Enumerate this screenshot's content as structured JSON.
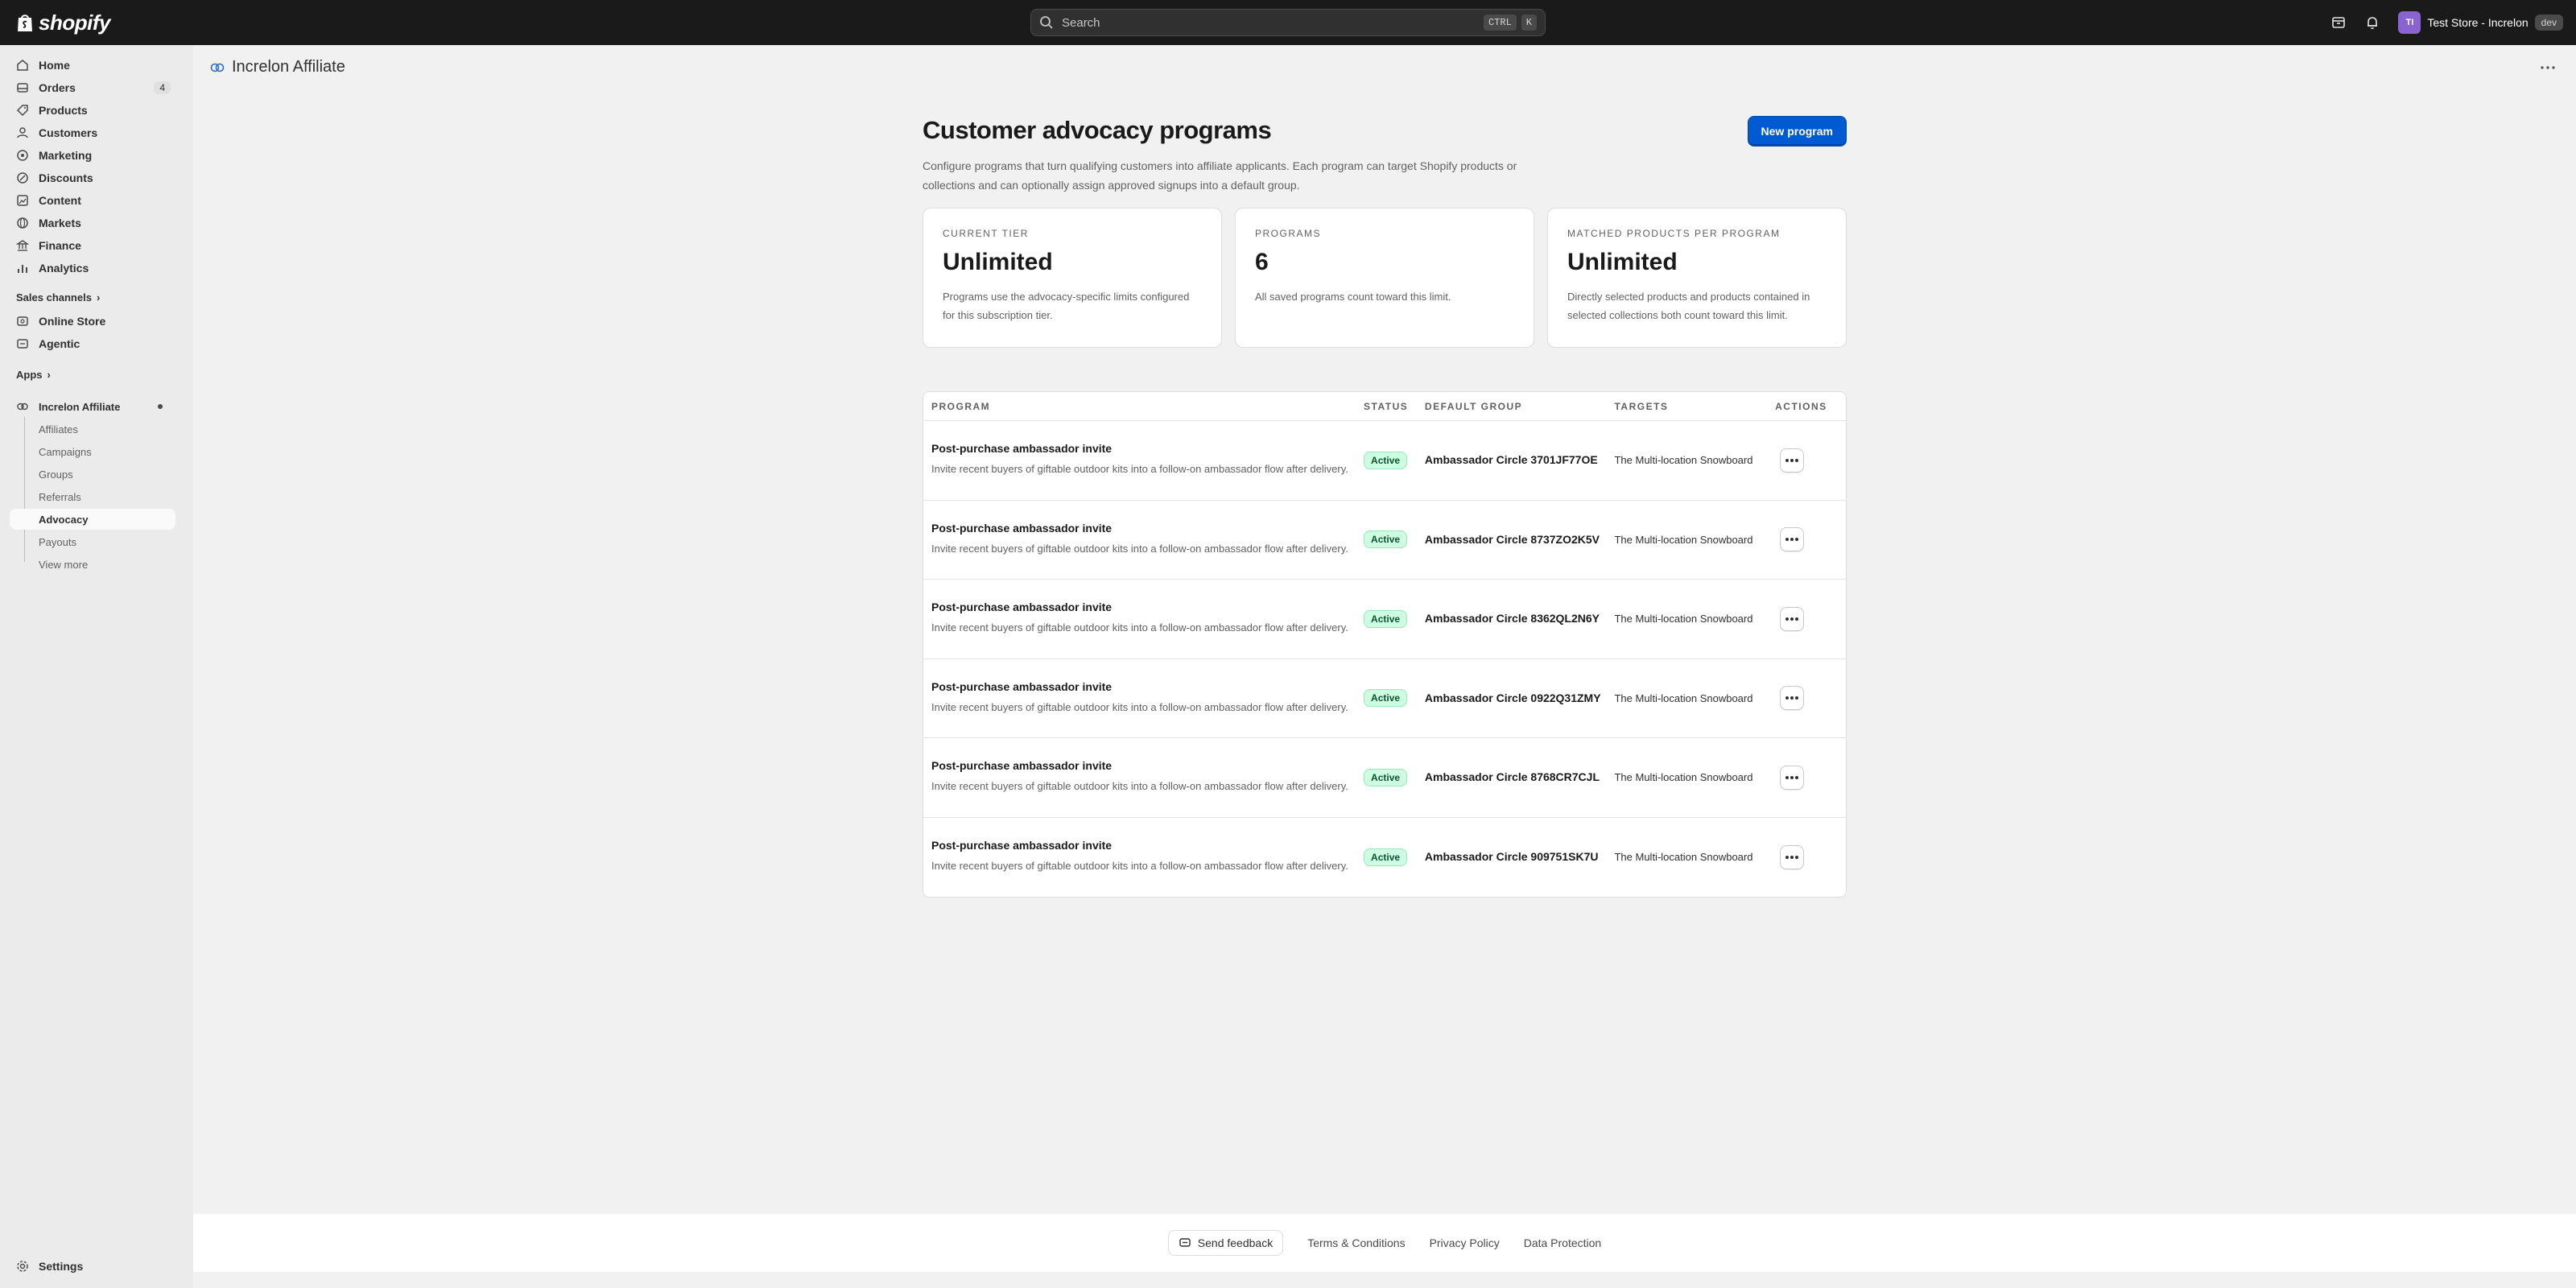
{
  "topbar": {
    "brand": "shopify",
    "search_placeholder": "Search",
    "shortcut_ctrl": "CTRL",
    "shortcut_key": "K",
    "avatar_initials": "TI",
    "store_name": "Test Store - Increlon",
    "store_badge": "dev"
  },
  "sidebar": {
    "items": [
      {
        "label": "Home",
        "icon": "home-icon"
      },
      {
        "label": "Orders",
        "icon": "orders-icon",
        "count": "4"
      },
      {
        "label": "Products",
        "icon": "products-icon"
      },
      {
        "label": "Customers",
        "icon": "customers-icon"
      },
      {
        "label": "Marketing",
        "icon": "marketing-icon"
      },
      {
        "label": "Discounts",
        "icon": "discounts-icon"
      },
      {
        "label": "Content",
        "icon": "content-icon"
      },
      {
        "label": "Markets",
        "icon": "markets-icon"
      },
      {
        "label": "Finance",
        "icon": "finance-icon"
      },
      {
        "label": "Analytics",
        "icon": "analytics-icon"
      }
    ],
    "sales_channels_label": "Sales channels",
    "channels": [
      {
        "label": "Online Store"
      },
      {
        "label": "Agentic"
      }
    ],
    "apps_label": "Apps",
    "app_name": "Increlon Affiliate",
    "app_sub_items": [
      "Affiliates",
      "Campaigns",
      "Groups",
      "Referrals",
      "Advocacy",
      "Payouts",
      "View more"
    ],
    "settings_label": "Settings"
  },
  "page": {
    "app_title": "Increlon Affiliate",
    "title": "Customer advocacy programs",
    "subtitle": "Configure programs that turn qualifying customers into affiliate applicants. Each program can target Shopify products or collections and can optionally assign approved signups into a default group.",
    "new_button": "New program"
  },
  "cards": [
    {
      "label": "CURRENT TIER",
      "value": "Unlimited",
      "desc": "Programs use the advocacy-specific limits configured for this subscription tier."
    },
    {
      "label": "PROGRAMS",
      "value": "6",
      "desc": "All saved programs count toward this limit."
    },
    {
      "label": "MATCHED PRODUCTS PER PROGRAM",
      "value": "Unlimited",
      "desc": "Directly selected products and products contained in selected collections both count toward this limit."
    }
  ],
  "table": {
    "headers": [
      "PROGRAM",
      "STATUS",
      "DEFAULT GROUP",
      "TARGETS",
      "ACTIONS"
    ],
    "rows": [
      {
        "name": "Post-purchase ambassador invite",
        "desc": "Invite recent buyers of giftable outdoor kits into a follow-on ambassador flow after delivery.",
        "status": "Active",
        "group": "Ambassador Circle 3701JF77OE",
        "target": "The Multi-location Snowboard"
      },
      {
        "name": "Post-purchase ambassador invite",
        "desc": "Invite recent buyers of giftable outdoor kits into a follow-on ambassador flow after delivery.",
        "status": "Active",
        "group": "Ambassador Circle 8737ZO2K5V",
        "target": "The Multi-location Snowboard"
      },
      {
        "name": "Post-purchase ambassador invite",
        "desc": "Invite recent buyers of giftable outdoor kits into a follow-on ambassador flow after delivery.",
        "status": "Active",
        "group": "Ambassador Circle 8362QL2N6Y",
        "target": "The Multi-location Snowboard"
      },
      {
        "name": "Post-purchase ambassador invite",
        "desc": "Invite recent buyers of giftable outdoor kits into a follow-on ambassador flow after delivery.",
        "status": "Active",
        "group": "Ambassador Circle 0922Q31ZMY",
        "target": "The Multi-location Snowboard"
      },
      {
        "name": "Post-purchase ambassador invite",
        "desc": "Invite recent buyers of giftable outdoor kits into a follow-on ambassador flow after delivery.",
        "status": "Active",
        "group": "Ambassador Circle 8768CR7CJL",
        "target": "The Multi-location Snowboard"
      },
      {
        "name": "Post-purchase ambassador invite",
        "desc": "Invite recent buyers of giftable outdoor kits into a follow-on ambassador flow after delivery.",
        "status": "Active",
        "group": "Ambassador Circle 909751SK7U",
        "target": "The Multi-location Snowboard"
      }
    ]
  },
  "footer": {
    "feedback": "Send feedback",
    "links": [
      "Terms & Conditions",
      "Privacy Policy",
      "Data Protection"
    ]
  },
  "colors": {
    "topbar": "#1a1a1a",
    "primary_button": "#005bd3",
    "status_active_bg": "#cdfee1",
    "status_active_text": "#0c5132"
  }
}
